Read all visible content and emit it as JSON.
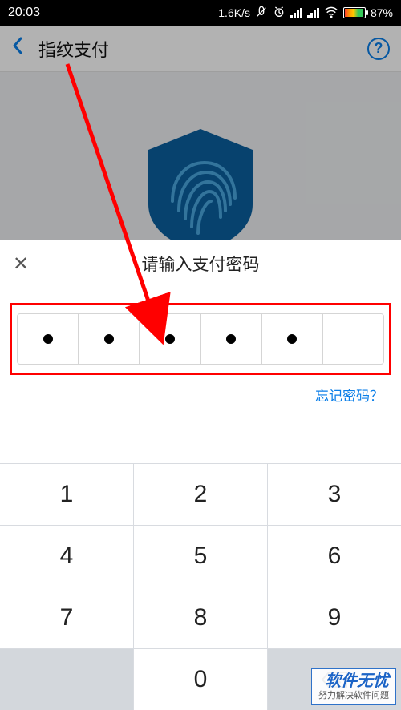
{
  "status_bar": {
    "time": "20:03",
    "net_speed": "1.6K/s",
    "battery_percent": "87%"
  },
  "header": {
    "title": "指纹支付",
    "help_label": "?"
  },
  "sheet": {
    "title": "请输入支付密码",
    "close_label": "✕",
    "entered_digits": 5,
    "total_digits": 6,
    "forgot_password": "忘记密码？"
  },
  "keypad": {
    "keys": [
      "1",
      "2",
      "3",
      "4",
      "5",
      "6",
      "7",
      "8",
      "9",
      "",
      "0",
      "⌫"
    ]
  },
  "watermark": {
    "big": "软件无忧",
    "small": "努力解决软件问题"
  },
  "colors": {
    "accent": "#0a7ee8",
    "annotation": "#ff0000",
    "shield": "#0b5f9e"
  }
}
